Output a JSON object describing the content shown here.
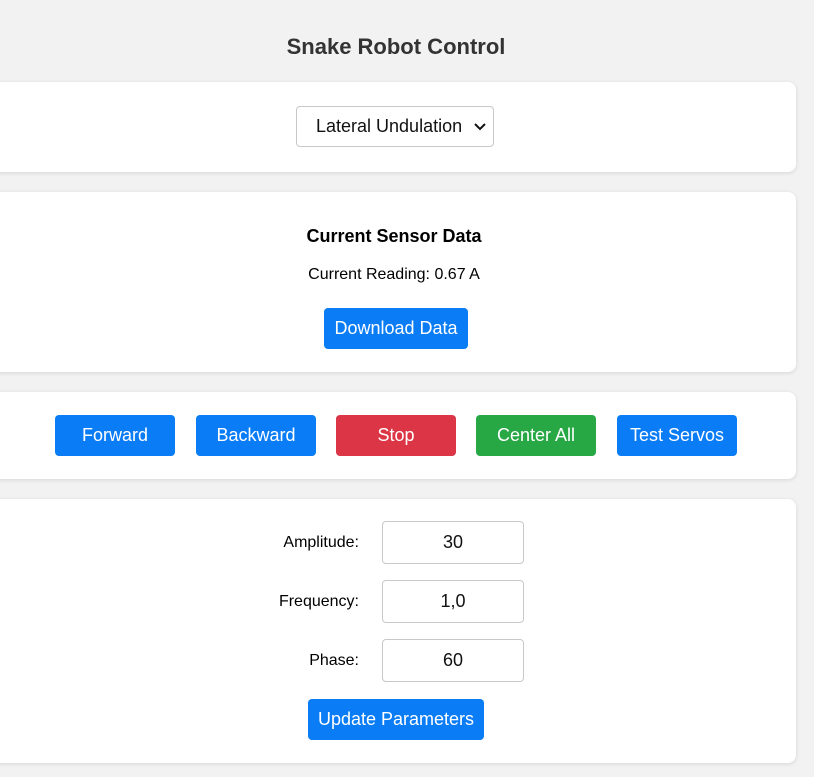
{
  "app": {
    "title": "Snake Robot Control"
  },
  "mode": {
    "selected": "Lateral Undulation"
  },
  "sensor": {
    "heading": "Current Sensor Data",
    "reading": "Current Reading: 0.67 A",
    "download_label": "Download Data"
  },
  "controls": {
    "forward": "Forward",
    "backward": "Backward",
    "stop": "Stop",
    "center_all": "Center All",
    "test_servos": "Test Servos"
  },
  "params": {
    "amplitude_label": "Amplitude:",
    "amplitude_value": "30",
    "frequency_label": "Frequency:",
    "frequency_value": "1,0",
    "phase_label": "Phase:",
    "phase_value": "60",
    "update_label": "Update Parameters"
  },
  "colors": {
    "primary": "#0a7cf5",
    "danger": "#dc3545",
    "success": "#28a745",
    "background": "#f2f2f2"
  },
  "icons": {
    "select_arrow": "chevron-down-icon"
  }
}
